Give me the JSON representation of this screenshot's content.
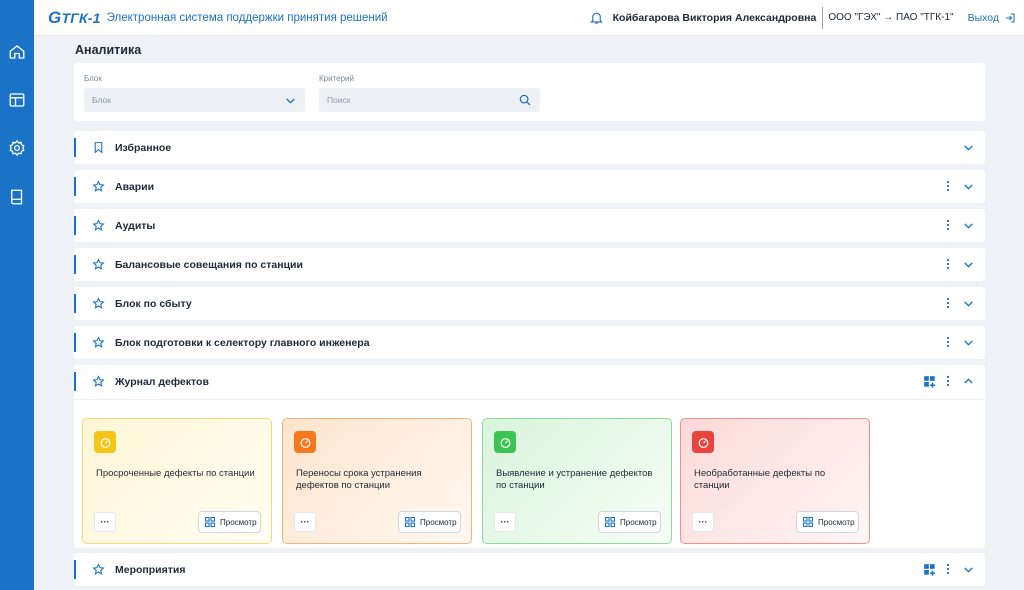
{
  "header": {
    "logo_text": "ТГК-1",
    "logo_g": "G",
    "app_title": "Электронная система поддержки принятия решений",
    "user_name": "Койбагарова Виктория Александровна",
    "org": "ООО \"ГЭХ\" → ПАО \"ТГК-1\"",
    "logout_label": "Выход"
  },
  "sidebar": {
    "items": [
      {
        "icon": "home-icon"
      },
      {
        "icon": "layout-icon"
      },
      {
        "icon": "gear-icon"
      },
      {
        "icon": "book-icon"
      }
    ]
  },
  "page": {
    "title": "Аналитика"
  },
  "filters": {
    "block_label": "Блок",
    "block_value": "Блок",
    "criteria_label": "Критерий",
    "search_placeholder": "Поиск"
  },
  "sections": [
    {
      "title": "Избранное",
      "icon": "bookmark-icon",
      "has_menu": false,
      "expanded": false
    },
    {
      "title": "Аварии",
      "icon": "star-icon",
      "has_menu": true,
      "expanded": false
    },
    {
      "title": "Аудиты",
      "icon": "star-icon",
      "has_menu": true,
      "expanded": false
    },
    {
      "title": "Балансовые совещания по станции",
      "icon": "star-icon",
      "has_menu": true,
      "expanded": false
    },
    {
      "title": "Блок по сбыту",
      "icon": "star-icon",
      "has_menu": true,
      "expanded": false
    },
    {
      "title": "Блок подготовки к селектору главного инженера",
      "icon": "star-icon",
      "has_menu": true,
      "expanded": false
    },
    {
      "title": "Журнал дефектов",
      "icon": "star-icon",
      "has_menu": true,
      "expanded": true
    },
    {
      "title": "Мероприятия",
      "icon": "star-icon",
      "has_menu": true,
      "expanded": false
    }
  ],
  "cards": [
    {
      "title": "Просроченные дефекты по станции",
      "more": "···",
      "view_label": "Просмотр",
      "icon_bg": "#f5c518",
      "bg_from": "#fff6d6",
      "bg_to": "#fffdf3",
      "border": "#f6d773"
    },
    {
      "title": "Переносы срока устранения дефектов по станции",
      "more": "···",
      "view_label": "Просмотр",
      "icon_bg": "#f5781e",
      "bg_from": "#ffe4cc",
      "bg_to": "#fff8f1",
      "border": "#f7b27a"
    },
    {
      "title": "Выявление и устранение дефектов по станции",
      "more": "···",
      "view_label": "Просмотр",
      "icon_bg": "#3cc453",
      "bg_from": "#d9f4dc",
      "bg_to": "#f6fdf7",
      "border": "#8fd99a"
    },
    {
      "title": "Необработанные дефекты по станции",
      "more": "···",
      "view_label": "Просмотр",
      "icon_bg": "#e8433d",
      "bg_from": "#fcd9d8",
      "bg_to": "#fff5f5",
      "border": "#f2908c"
    }
  ],
  "colors": {
    "primary": "#1a73c6",
    "background": "#eef1f5"
  }
}
